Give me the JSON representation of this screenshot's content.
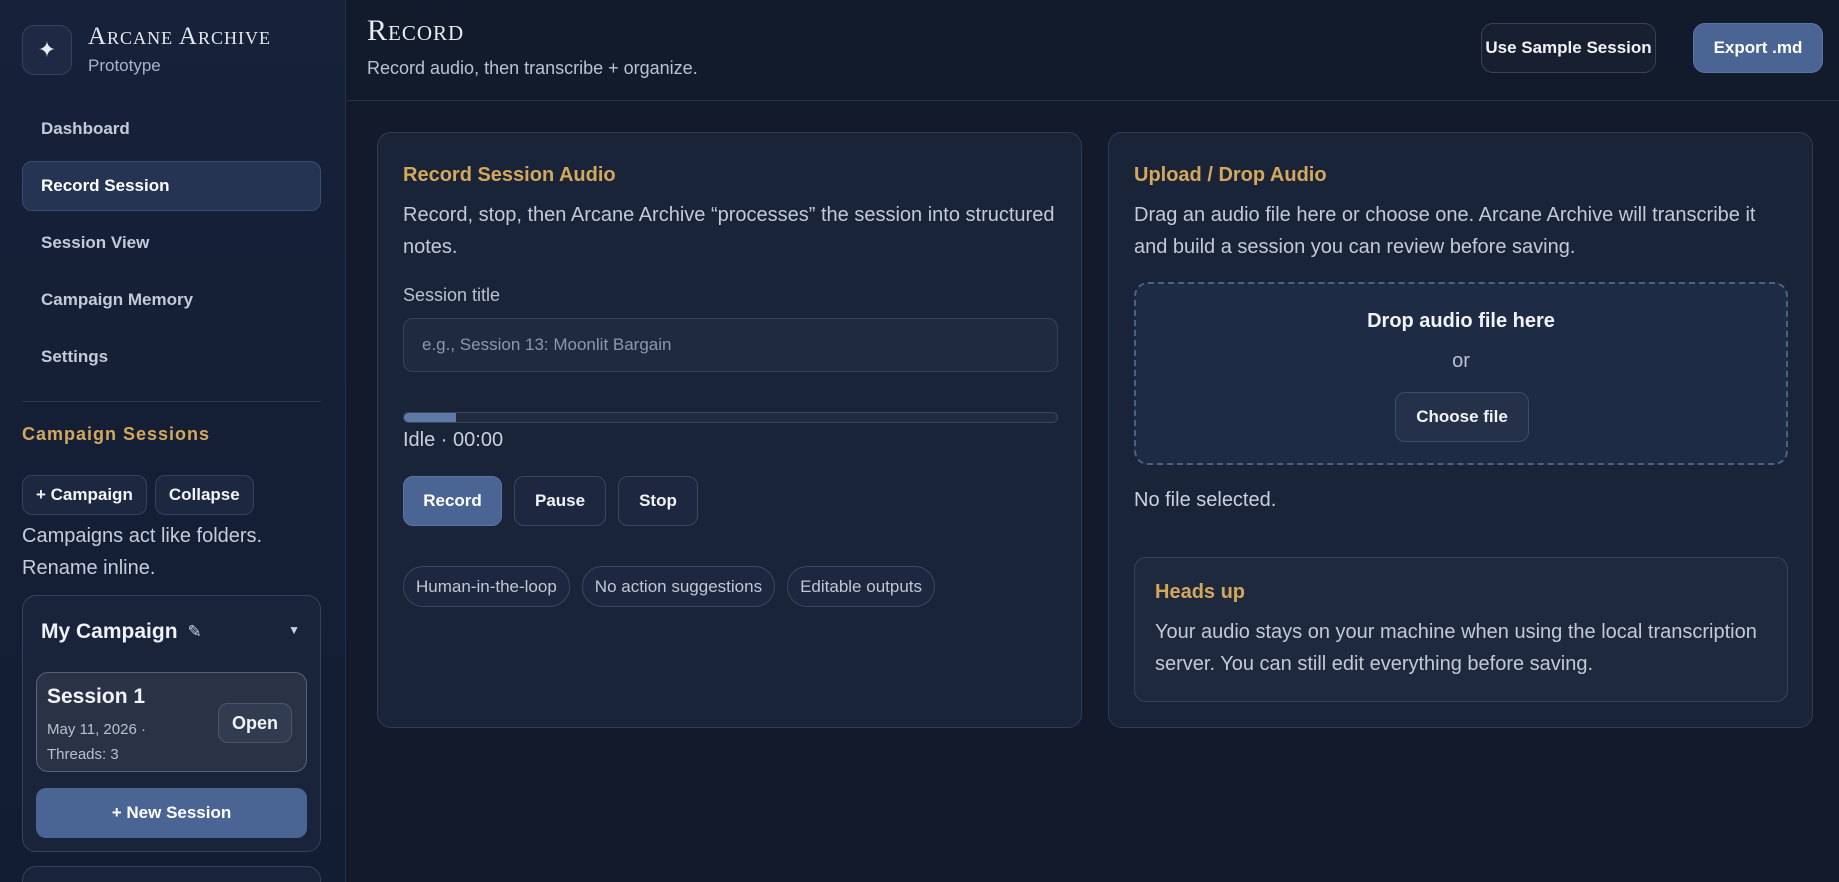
{
  "brand": {
    "logo_glyph": "✦",
    "name": "Arcane Archive",
    "subtitle": "Prototype"
  },
  "nav": {
    "items": [
      {
        "label": "Dashboard",
        "active": false
      },
      {
        "label": "Record Session",
        "active": true
      },
      {
        "label": "Session View",
        "active": false
      },
      {
        "label": "Campaign Memory",
        "active": false
      },
      {
        "label": "Settings",
        "active": false
      }
    ]
  },
  "sidebar": {
    "section_title": "Campaign Sessions",
    "add_campaign_label": "+ Campaign",
    "collapse_label": "Collapse",
    "note": "Campaigns act like folders. Rename inline.",
    "campaign": {
      "name": "My Campaign",
      "edit_glyph": "✎",
      "toggle_glyph": "▼",
      "session": {
        "title": "Session 1",
        "meta": "May 11, 2026 · Threads: 3",
        "open_label": "Open"
      },
      "new_session_label": "+ New Session"
    }
  },
  "header": {
    "title": "Record",
    "subtitle": "Record audio, then transcribe + organize.",
    "sample_label": "Use Sample Session",
    "export_label": "Export .md"
  },
  "record_panel": {
    "title": "Record Session Audio",
    "description": "Record, stop, then Arcane Archive “processes” the session into structured notes.",
    "session_title_label": "Session title",
    "session_title_placeholder": "e.g., Session 13: Moonlit Bargain",
    "session_title_value": "",
    "progress_percent": 8,
    "status": "Idle · 00:00",
    "record_label": "Record",
    "pause_label": "Pause",
    "stop_label": "Stop",
    "chips": [
      "Human-in-the-loop",
      "No action suggestions",
      "Editable outputs"
    ]
  },
  "upload_panel": {
    "title": "Upload / Drop Audio",
    "description": "Drag an audio file here or choose one. Arcane Archive will transcribe it and build a session you can review before saving.",
    "drop_title": "Drop audio file here",
    "drop_or": "or",
    "choose_label": "Choose file",
    "file_status": "No file selected.",
    "notice_title": "Heads up",
    "notice_body": "Your audio stays on your machine when using the local transcription server. You can still edit everything before saving."
  },
  "colors": {
    "accent": "#4a6494",
    "gold": "#d4a85c",
    "background": "#121a2b"
  }
}
